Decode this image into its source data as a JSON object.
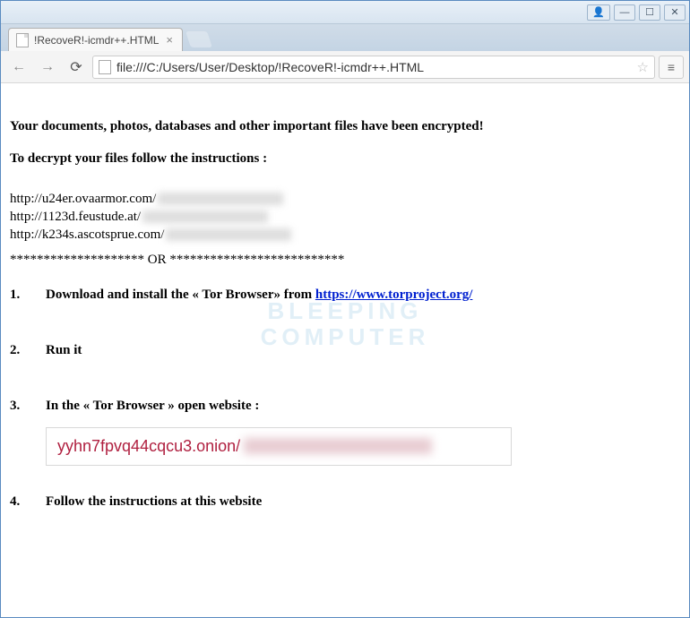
{
  "window": {
    "controls": {
      "user": "👤",
      "minimize": "—",
      "maximize": "☐",
      "close": "✕"
    }
  },
  "tab": {
    "title": "!RecoveR!-icmdr++.HTML",
    "close": "×"
  },
  "toolbar": {
    "back": "←",
    "forward": "→",
    "reload": "⟳",
    "url": "file:///C:/Users/User/Desktop/!RecoveR!-icmdr++.HTML",
    "star": "☆",
    "menu": "≡"
  },
  "page": {
    "heading1": "Your documents, photos, databases and other important files have been encrypted!",
    "heading2": "To decrypt your files follow the instructions :",
    "urls": [
      "http://u24er.ovaarmor.com/",
      "http://1123d.feustude.at/",
      "http://k234s.ascotsprue.com/"
    ],
    "divider": "******************** OR **************************",
    "steps": {
      "s1": {
        "num": "1.",
        "pre": "Download and install the « Tor Browser» from ",
        "link": "https://www.torproject.org/"
      },
      "s2": {
        "num": "2.",
        "text": "Run it"
      },
      "s3": {
        "num": "3.",
        "text": "In the « Tor Browser » open website :"
      },
      "s4": {
        "num": "4.",
        "text": "Follow the instructions at this website"
      }
    },
    "onion": "yyhn7fpvq44cqcu3.onion/",
    "watermark_line1": "BLEEPING",
    "watermark_line2": "COMPUTER"
  }
}
